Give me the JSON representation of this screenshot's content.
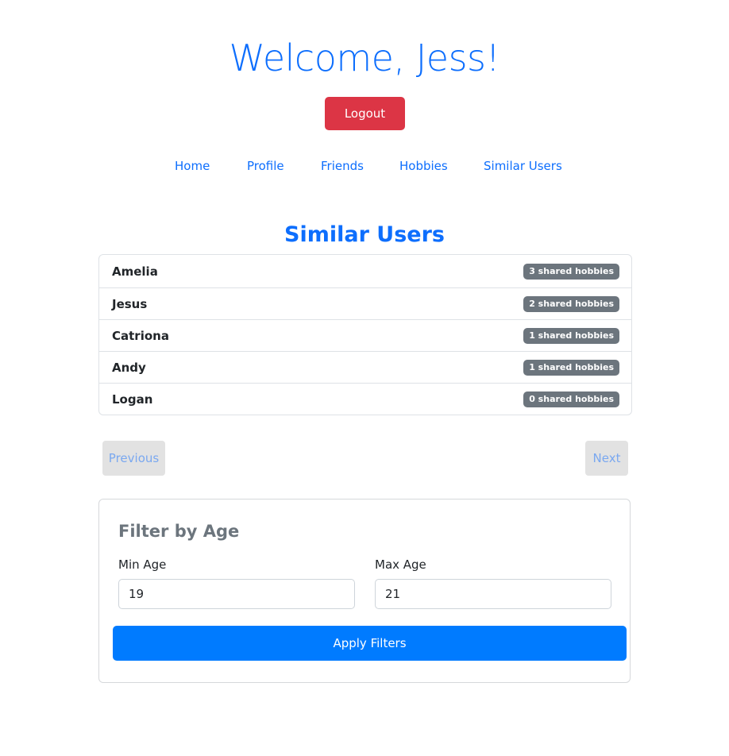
{
  "header": {
    "welcome": "Welcome, Jess!",
    "logout_label": "Logout"
  },
  "nav": {
    "items": [
      {
        "label": "Home"
      },
      {
        "label": "Profile"
      },
      {
        "label": "Friends"
      },
      {
        "label": "Hobbies"
      },
      {
        "label": "Similar Users"
      }
    ]
  },
  "similar_users": {
    "title": "Similar Users",
    "users": [
      {
        "name": "Amelia",
        "shared": "3 shared hobbies"
      },
      {
        "name": "Jesus",
        "shared": "2 shared hobbies"
      },
      {
        "name": "Catriona",
        "shared": "1 shared hobbies"
      },
      {
        "name": "Andy",
        "shared": "1 shared hobbies"
      },
      {
        "name": "Logan",
        "shared": "0 shared hobbies"
      }
    ]
  },
  "pagination": {
    "previous_label": "Previous",
    "next_label": "Next"
  },
  "filter": {
    "title": "Filter by Age",
    "min_label": "Min Age",
    "min_value": "19",
    "max_label": "Max Age",
    "max_value": "21",
    "apply_label": "Apply Filters"
  },
  "colors": {
    "primary": "#0d6efd",
    "danger": "#dc3545",
    "badge": "#6c757d",
    "apply": "#007bff"
  }
}
